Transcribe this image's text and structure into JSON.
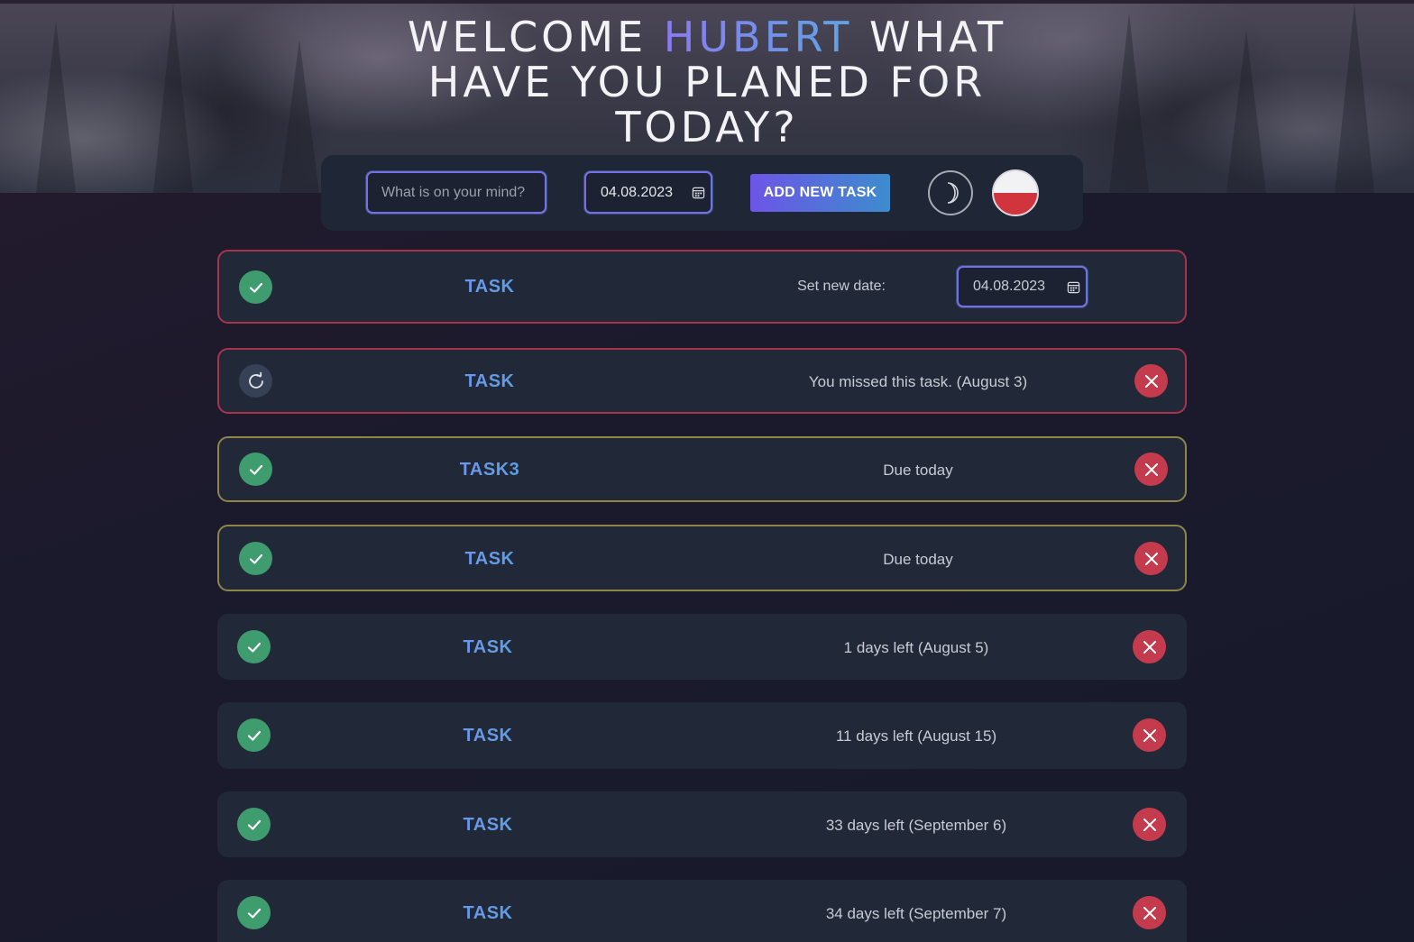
{
  "header": {
    "welcome": "WELCOME",
    "user_name": "HUBERT",
    "line1_tail": "WHAT",
    "line2": "HAVE YOU PLANED FOR",
    "line3": "TODAY?"
  },
  "toolbar": {
    "task_placeholder": "What is on your mind?",
    "date_value": "04.08.2023",
    "add_label": "ADD NEW TASK",
    "theme_icon": "moon-icon",
    "language_icon": "poland-flag-icon"
  },
  "colors": {
    "accent_start": "#6d55e6",
    "accent_end": "#3d8ccd",
    "complete_green": "#3f9c6f",
    "delete_red": "#c43b4d",
    "missed_border": "#a8344c",
    "due_border": "#8f8549"
  },
  "tasks": [
    {
      "name": "TASK",
      "new_date_label": "Set new date:",
      "new_date_value": "04.08.2023",
      "state": "editing-date"
    },
    {
      "name": "TASK",
      "status": "You missed this task. (August 3)",
      "state": "missed"
    },
    {
      "name": "TASK3",
      "status": "Due today",
      "state": "due"
    },
    {
      "name": "TASK",
      "status": "Due today",
      "state": "due"
    },
    {
      "name": "TASK",
      "status": "1 days left (August 5)",
      "state": "upcoming"
    },
    {
      "name": "TASK",
      "status": "11 days left (August 15)",
      "state": "upcoming"
    },
    {
      "name": "TASK",
      "status": "33 days left (September 6)",
      "state": "upcoming"
    },
    {
      "name": "TASK",
      "status": "34 days left (September 7)",
      "state": "upcoming"
    }
  ]
}
